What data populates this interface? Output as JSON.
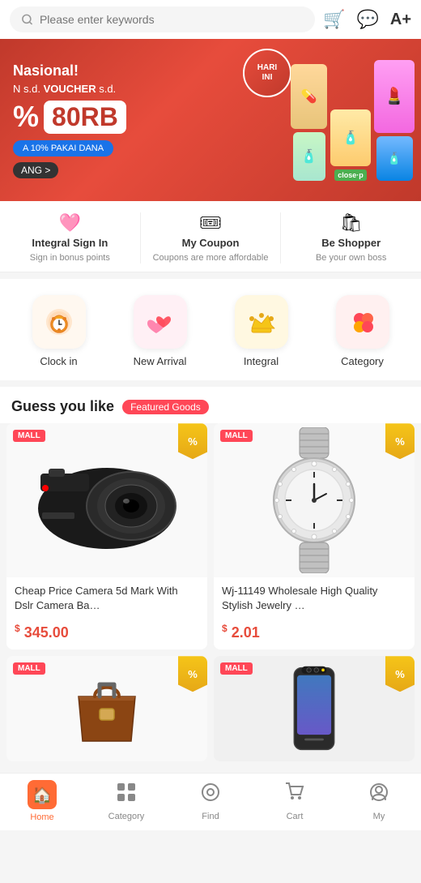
{
  "search": {
    "placeholder": "Please enter keywords"
  },
  "header": {
    "cart_icon": "🛒",
    "chat_icon": "💬",
    "translate_icon": "A+"
  },
  "banner": {
    "nasional": "Nasional!",
    "voucher_label": "N s.d. VOUCHER s.d.",
    "percent": "%",
    "amount": "80RB",
    "dana_text": "A 10% PAKAI DANA",
    "hari_ini": "HARI\nINI",
    "ang_button": "ANG >"
  },
  "quick_actions": [
    {
      "id": "integral-sign-in",
      "icon": "🩷",
      "title": "Integral Sign In",
      "subtitle": "Sign in bonus points"
    },
    {
      "id": "my-coupon",
      "icon": "🎟",
      "title": "My Coupon",
      "subtitle": "Coupons are more affordable"
    },
    {
      "id": "be-shopper",
      "icon": "🛍",
      "title": "Be Shopper",
      "subtitle": "Be your own boss"
    }
  ],
  "categories": [
    {
      "id": "clock-in",
      "icon": "⏰",
      "label": "Clock in"
    },
    {
      "id": "new-arrival",
      "icon": "💕",
      "label": "New Arrival"
    },
    {
      "id": "integral",
      "icon": "👑",
      "label": "Integral"
    },
    {
      "id": "category",
      "icon": "🔴",
      "label": "Category"
    }
  ],
  "section": {
    "title": "Guess you like",
    "badge": "Featured Goods"
  },
  "products": [
    {
      "id": "product-1",
      "mall": "MALL",
      "show_percent": true,
      "name": "Cheap Price Camera 5d Mark With Dslr Camera Ba…",
      "price": "345.00",
      "currency": "$",
      "type": "camera"
    },
    {
      "id": "product-2",
      "mall": "MALL",
      "show_percent": true,
      "name": "Wj-11149 Wholesale High Quality Stylish Jewelry …",
      "price": "2.01",
      "currency": "$",
      "type": "watch"
    }
  ],
  "bottom_nav": [
    {
      "id": "home",
      "icon": "🏠",
      "label": "Home",
      "active": true
    },
    {
      "id": "category",
      "icon": "⊞",
      "label": "Category",
      "active": false
    },
    {
      "id": "find",
      "icon": "◎",
      "label": "Find",
      "active": false
    },
    {
      "id": "cart",
      "icon": "🛒",
      "label": "Cart",
      "active": false
    },
    {
      "id": "my",
      "icon": "○",
      "label": "My",
      "active": false
    }
  ]
}
